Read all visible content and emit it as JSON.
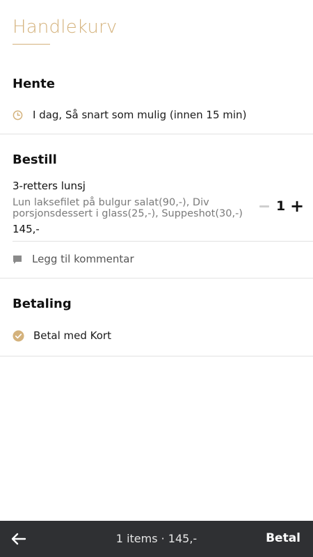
{
  "header": {
    "title": "Handlekurv"
  },
  "pickup": {
    "title": "Hente",
    "time_text": "I dag, Så snart som mulig (innen 15 min)",
    "icon": "clock-icon"
  },
  "order": {
    "title": "Bestill",
    "items": [
      {
        "name": "3-retters lunsj",
        "description": "Lun laksefilet på bulgur salat(90,-), Div porsjonsdessert i glass(25,-), Suppeshot(30,-)",
        "price": "145,-",
        "quantity": "1",
        "minus_label": "−",
        "plus_label": "+"
      }
    ],
    "comment_label": "Legg til kommentar",
    "comment_icon": "comment-icon"
  },
  "payment": {
    "title": "Betaling",
    "method": "Betal med Kort",
    "icon": "check-circle-icon"
  },
  "bottom_bar": {
    "summary": "1 items · 145,-",
    "pay_label": "Betal",
    "back_icon": "arrow-left-icon"
  },
  "colors": {
    "accent": "#d4b27c",
    "bar_bg": "#2f3033",
    "text": "#111111",
    "muted": "#7a7a7a"
  }
}
